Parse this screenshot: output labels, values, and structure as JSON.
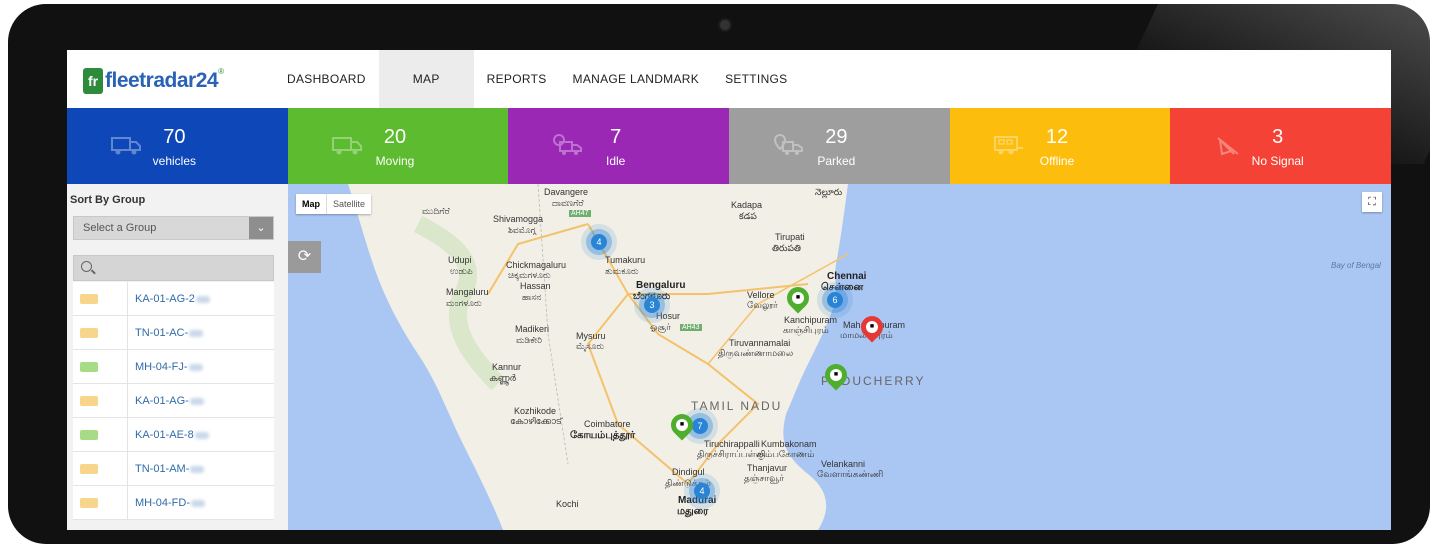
{
  "nav": {
    "logo_text": "fleetradar24",
    "logo_mark": "fr",
    "items": [
      {
        "label": "DASHBOARD",
        "active": false
      },
      {
        "label": "MAP",
        "active": true
      },
      {
        "label": "REPORTS",
        "active": false
      },
      {
        "label": "MANAGE LANDMARK",
        "active": false
      },
      {
        "label": "SETTINGS",
        "active": false
      }
    ]
  },
  "stats": [
    {
      "count": "70",
      "label": "vehicles",
      "color": "#0d47b8",
      "icon": "truck-icon"
    },
    {
      "count": "20",
      "label": "Moving",
      "color": "#5cbb2e",
      "icon": "moving-truck-icon"
    },
    {
      "count": "7",
      "label": "Idle",
      "color": "#9b27b5",
      "icon": "idle-truck-icon"
    },
    {
      "count": "29",
      "label": "Parked",
      "color": "#9e9e9e",
      "icon": "parked-truck-icon"
    },
    {
      "count": "12",
      "label": "Offline",
      "color": "#fcbd0c",
      "icon": "offline-truck-icon"
    },
    {
      "count": "3",
      "label": "No Signal",
      "color": "#f44336",
      "icon": "no-signal-icon"
    }
  ],
  "sidebar": {
    "title": "Sort By Group",
    "group_select": "Select a Group",
    "search_placeholder": "",
    "vehicles": [
      {
        "plate": "KA-01-AG-2",
        "status_color": "#f7d58a"
      },
      {
        "plate": "TN-01-AC-",
        "status_color": "#f7d58a"
      },
      {
        "plate": "MH-04-FJ-",
        "status_color": "#a6dc86"
      },
      {
        "plate": "KA-01-AG-",
        "status_color": "#f7d58a"
      },
      {
        "plate": "KA-01-AE-8",
        "status_color": "#a6dc86"
      },
      {
        "plate": "TN-01-AM-",
        "status_color": "#f7d58a"
      },
      {
        "plate": "MH-04-FD-",
        "status_color": "#f7d58a"
      }
    ]
  },
  "map": {
    "type_buttons": [
      "Map",
      "Satellite"
    ],
    "labels": {
      "davangere": "Davangere",
      "davangere_local": "ದಾವಣಗೆರೆ",
      "shivamogga": "Shivamogga",
      "shivamogga_local": "ಶಿವಮೊಗ್ಗ",
      "kadapa": "Kadapa",
      "kadapa_local": "కడప",
      "tirupati": "Tirupati",
      "tirupati_local": "తిరుపతి",
      "udupi": "Udupi",
      "udupi_local": "ಉಡುಪಿ",
      "chikmagalur": "Chickmagaluru",
      "chikmagalur_local": "ಚಿಕ್ಕಮಗಳೂರು",
      "tumakuru": "Tumakuru",
      "tumakuru_local": "ತುಮಕೂರು",
      "hassan": "Hassan",
      "hassan_local": "ಹಾಸನ",
      "bengaluru": "Bengaluru",
      "bengaluru_local": "ಬೆಂಗಳೂರು",
      "vellore": "Vellore",
      "vellore_local": "வேலூர்",
      "chennai": "Chennai",
      "chennai_local": "சென்னை",
      "mangaluru": "Mangaluru",
      "mangaluru_local": "ಮಂಗಳೂರು",
      "hosur": "Hosur",
      "hosur_local": "ஓசூர்",
      "madikeri": "Madikeri",
      "madikeri_local": "ಮಡಿಕೇರಿ",
      "mysuru": "Mysuru",
      "mysuru_local": "ಮೈಸೂರು",
      "kanchipuram": "Kanchipuram",
      "kanchipuram_local": "காஞ்சிபுரம்",
      "mahabalipuram": "Mahabalipuram",
      "mahabalipuram_local": "மாமல்லபுரம்",
      "tiruvannamalai": "Tiruvannamalai",
      "tiruvannamalai_local": "திருவண்ணாமலை",
      "kannur": "Kannur",
      "kannur_local": "കണ്ണൂർ",
      "puducherry": "PUDUCHERRY",
      "tamil_nadu": "TAMIL NADU",
      "kozhikode": "Kozhikode",
      "kozhikode_local": "കോഴിക്കോട്",
      "coimbatore": "Coimbatore",
      "coimbatore_local": "கோயம்புத்தூர்",
      "tiruchirappalli": "Tiruchirappalli",
      "tiruchirappalli_local": "திருச்சிராப்பள்ளி",
      "kumbakonam": "Kumbakonam",
      "kumbakonam_local": "கும்பகோணம்",
      "thanjavur": "Thanjavur",
      "thanjavur_local": "தஞ்சாவூர்",
      "velankanni": "Velankanni",
      "velankanni_local": "வேளாங்கண்ணி",
      "dindigul": "Dindigul",
      "dindigul_local": "திண்டுக்கல்",
      "madurai": "Madurai",
      "madurai_local": "மதுரை",
      "kochi": "Kochi",
      "bay": "Bay of Bengal",
      "nellore_local": "నెల్లూరు",
      "mudigere_local": "ಮುದಿಗೆರೆ",
      "ah47": "AH47",
      "ah43": "AH43"
    },
    "clusters": [
      "4",
      "3",
      "6",
      "7",
      "4"
    ],
    "land_color": "#f1efe6",
    "water_color": "#aac6f2"
  }
}
